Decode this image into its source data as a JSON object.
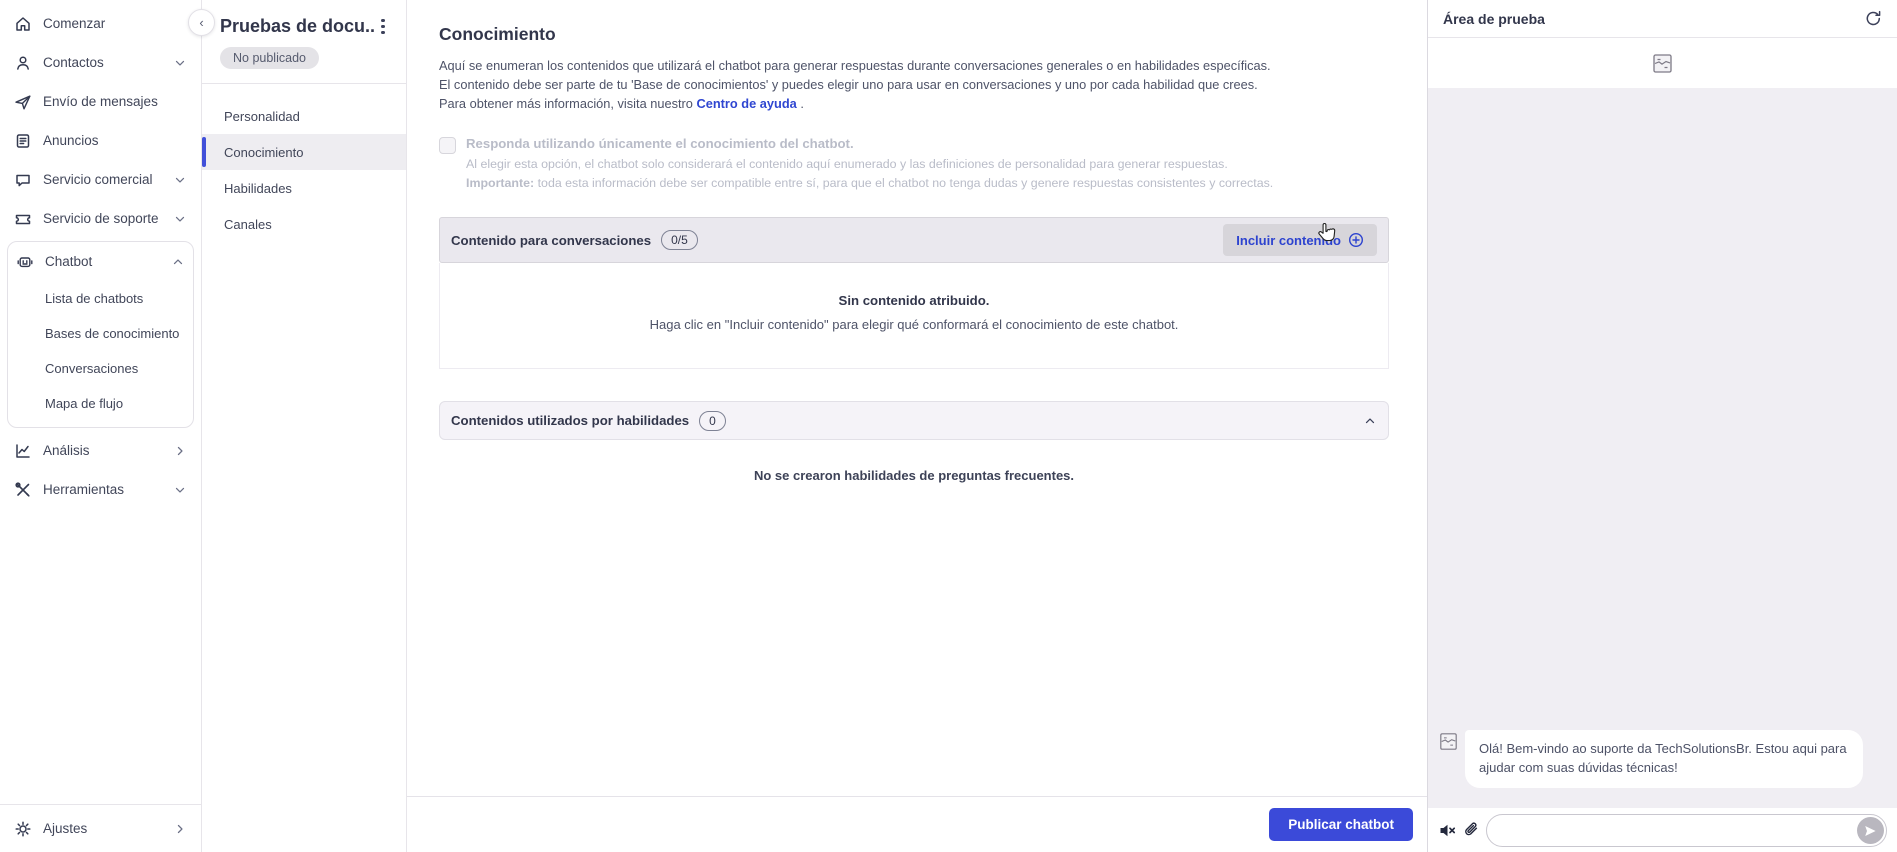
{
  "sidebar": {
    "items": [
      {
        "label": "Comenzar",
        "icon": "home-icon"
      },
      {
        "label": "Contactos",
        "icon": "contacts-icon",
        "chevron": "down"
      },
      {
        "label": "Envío de mensajes",
        "icon": "send-icon"
      },
      {
        "label": "Anuncios",
        "icon": "announcements-icon"
      },
      {
        "label": "Servicio comercial",
        "icon": "chat-icon",
        "chevron": "down"
      },
      {
        "label": "Servicio de soporte",
        "icon": "ticket-icon",
        "chevron": "down"
      }
    ],
    "chatbot_group": {
      "label": "Chatbot",
      "children": [
        {
          "label": "Lista de chatbots"
        },
        {
          "label": "Bases de conocimiento"
        },
        {
          "label": "Conversaciones"
        },
        {
          "label": "Mapa de flujo"
        }
      ]
    },
    "lower_items": [
      {
        "label": "Análisis",
        "icon": "analytics-icon",
        "chevron": "right"
      },
      {
        "label": "Herramientas",
        "icon": "tools-icon",
        "chevron": "down"
      }
    ],
    "footer": {
      "label": "Ajustes"
    }
  },
  "chatbot_nav": {
    "title": "Pruebas de docu...",
    "status_badge": "No publicado",
    "items": [
      {
        "label": "Personalidad"
      },
      {
        "label": "Conocimiento"
      },
      {
        "label": "Habilidades"
      },
      {
        "label": "Canales"
      }
    ],
    "selected": "Conocimiento"
  },
  "main": {
    "title": "Conocimiento",
    "intro_line1": "Aquí se enumeran los contenidos que utilizará el chatbot para generar respuestas durante conversaciones generales o en habilidades específicas.",
    "intro_line2": "El contenido debe ser parte de tu 'Base de conocimientos' y puedes elegir uno para usar en conversaciones y uno por cada habilidad que crees.",
    "intro_line3": "Para obtener más información, visita nuestro",
    "help_link": "Centro de ayuda",
    "intro_line3_suffix": ".",
    "knowledge_only": {
      "title": "Responda utilizando únicamente el conocimiento del chatbot.",
      "line1": "Al elegir esta opción, el chatbot solo considerará el contenido aquí enumerado y las definiciones de personalidad para generar respuestas.",
      "line2_label": "Importante:",
      "line2": "toda esta información debe ser compatible entre sí, para que el chatbot no tenga dudas y genere respuestas consistentes y correctas."
    },
    "conversations_section": {
      "title": "Contenido para conversaciones",
      "count_badge": "0/5",
      "button_label": "Incluir contenido",
      "empty_title": "Sin contenido atribuido.",
      "empty_subtitle": "Haga clic en \"Incluir contenido\" para elegir qué conformará el conocimiento de este chatbot."
    },
    "skills_section": {
      "title": "Contenidos utilizados por habilidades",
      "count_badge": "0",
      "empty_text": "No se crearon habilidades de preguntas frecuentes."
    },
    "publish_button": "Publicar chatbot"
  },
  "test_area": {
    "title": "Área de prueba",
    "bot_message": "Olá! Bem-vindo ao suporte da TechSolutionsBr. Estou aqui para ajudar com suas dúvidas técnicas!",
    "input_value": ""
  },
  "colors": {
    "accent_blue": "#3b4ad9",
    "link_blue": "#2f46d1",
    "selected_bar": "#4150d9",
    "chat_bg": "#f0eef3"
  }
}
